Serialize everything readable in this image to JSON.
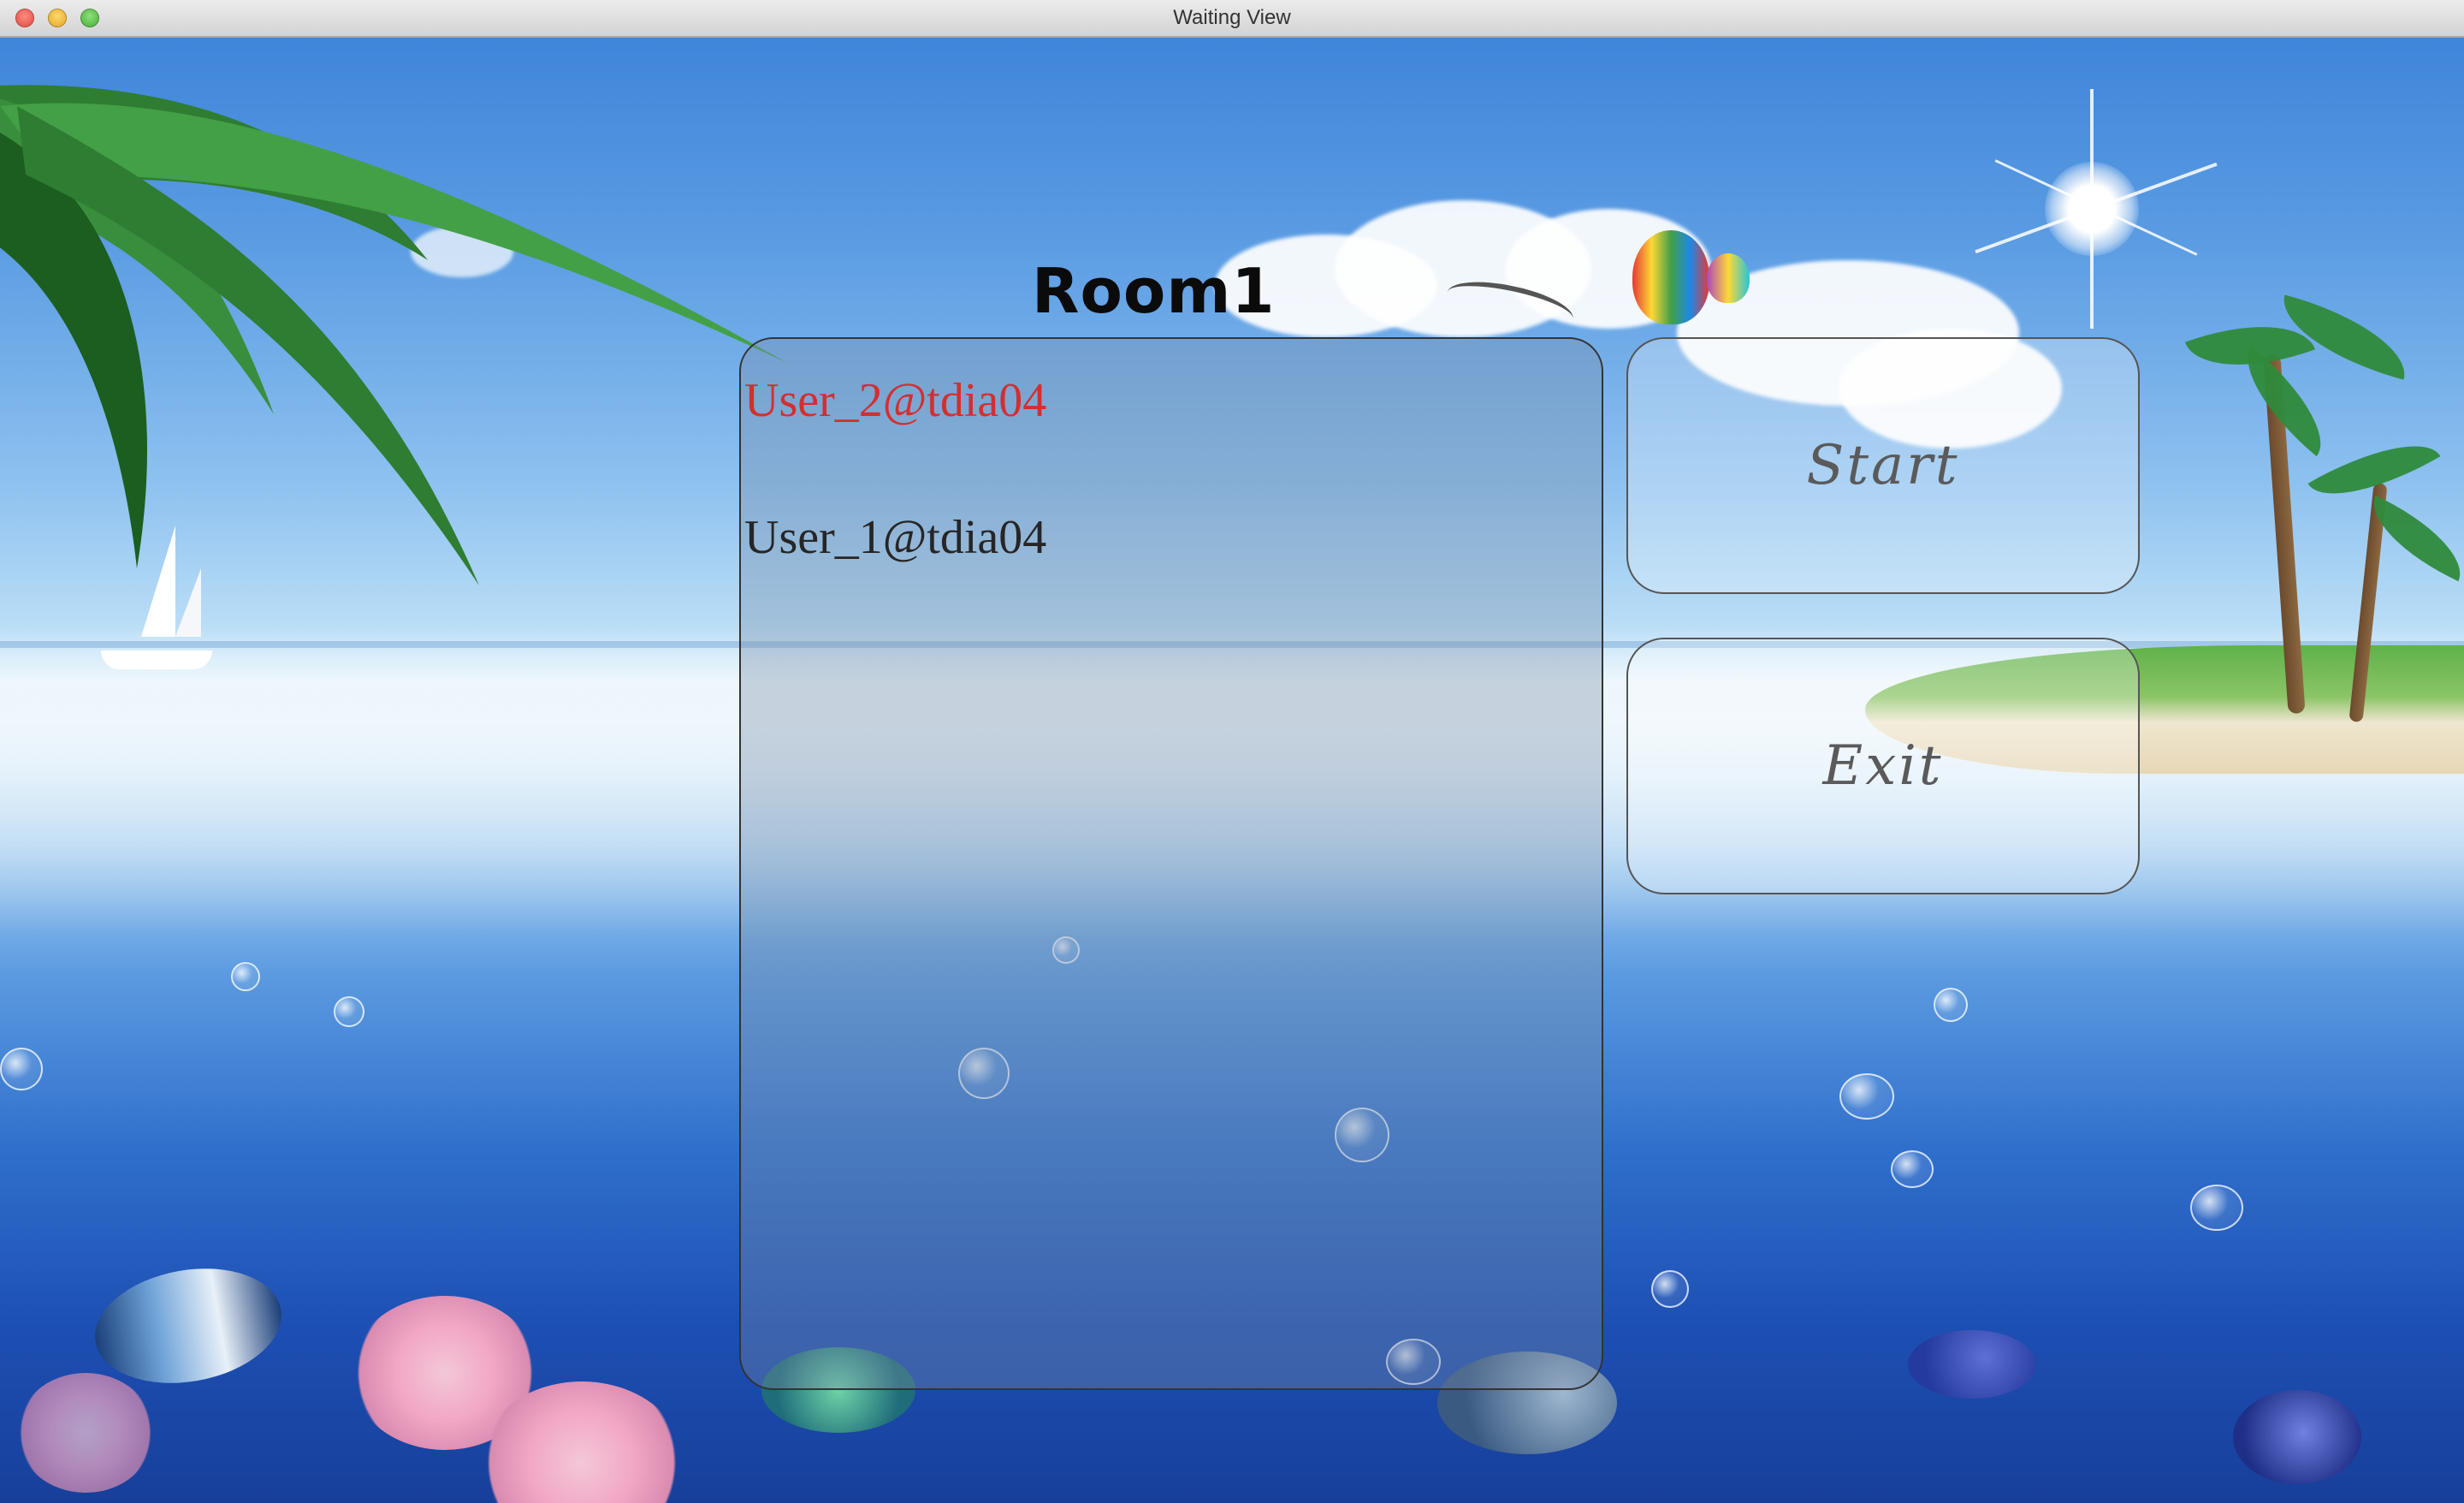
{
  "window": {
    "title": "Waiting View",
    "controls": [
      "close",
      "minimize",
      "zoom"
    ]
  },
  "room": {
    "name": "Room1",
    "users": [
      {
        "label": "User_2@tdia04",
        "color": "#d32f2f"
      },
      {
        "label": "User_1@tdia04",
        "color": "#262626"
      }
    ]
  },
  "actions": {
    "start_label": "Start",
    "exit_label": "Exit"
  },
  "background": {
    "theme": "tropical ocean with palm trees, sun, clouds, hot air balloons, fish and bubbles",
    "accent": "#3f85d9"
  }
}
